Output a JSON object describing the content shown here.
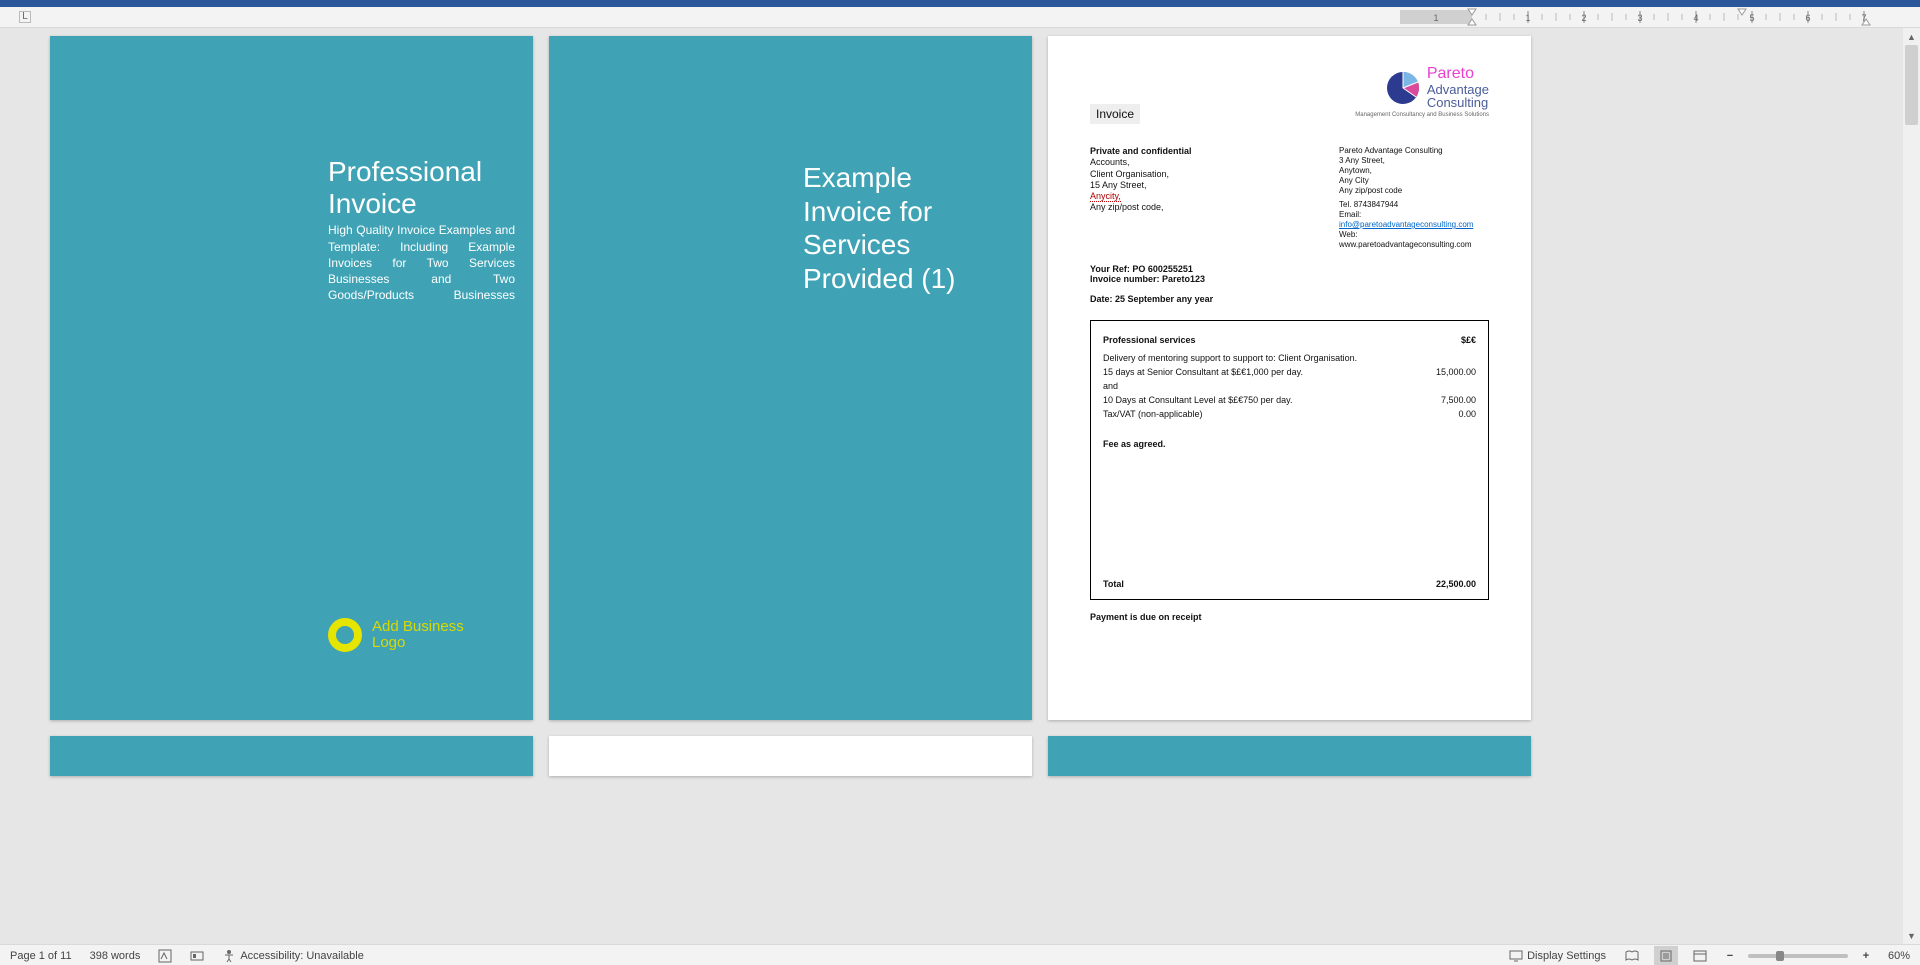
{
  "status": {
    "page_label": "Page 1 of 11",
    "word_count": "398 words",
    "accessibility": "Accessibility: Unavailable",
    "display_settings": "Display Settings",
    "zoom_value": "60%"
  },
  "ruler": {
    "margin_marks_left": [
      -1
    ],
    "marks": [
      1,
      2,
      3,
      4,
      5,
      6,
      7
    ]
  },
  "page1": {
    "title": "Professional Invoice",
    "subtitle": "High Quality Invoice Examples and Template: Including Example Invoices for Two Services Businesses and Two Goods/Products Businesses",
    "logo_text_line1": "Add Business",
    "logo_text_line2": "Logo"
  },
  "page2": {
    "title": "Example Invoice for Services Provided (1)"
  },
  "page3": {
    "invoice_label": "Invoice",
    "logo_name": "Pareto",
    "logo_sub1": "Advantage",
    "logo_sub2": "Consulting",
    "logo_tag": "Management Consultancy and Business Solutions",
    "recipient": {
      "private": "Private and confidential",
      "l1": "Accounts,",
      "l2": "Client Organisation,",
      "l3": "15 Any Street,",
      "l4": "Anycity,",
      "l5": "Any zip/post code,"
    },
    "sender": {
      "l1": "Pareto Advantage Consulting",
      "l2": "3 Any Street,",
      "l3": "Anytown,",
      "l4": "Any City",
      "l5": "Any zip/post code",
      "tel_label": "Tel.",
      "tel": "8743847944",
      "email_label": "Email:",
      "email": "info@paretoadvantageconsulting.com",
      "web_label": "Web:",
      "web": "www.paretoadvantageconsulting.com"
    },
    "your_ref_label": "Your Ref:",
    "your_ref_value": "PO 600255251",
    "invoice_no_label": "Invoice number:",
    "invoice_no_value": "Pareto123",
    "date_label": "Date:",
    "date_value": "25 September any year",
    "table": {
      "header_left": "Professional services",
      "header_right": "$£€",
      "lines": [
        {
          "left": "Delivery of mentoring support to support to: Client Organisation.",
          "right": ""
        },
        {
          "left": "15 days at Senior Consultant at $£€1,000 per day.",
          "right": "15,000.00"
        },
        {
          "left": "and",
          "right": ""
        },
        {
          "left": "10 Days at Consultant Level at $£€750 per day.",
          "right": "7,500.00"
        },
        {
          "left": "Tax/VAT (non-applicable)",
          "right": "0.00"
        }
      ],
      "fee_agreed": "Fee as agreed.",
      "total_label": "Total",
      "total_value": "22,500.00"
    },
    "payment_due": "Payment is due on receipt"
  }
}
